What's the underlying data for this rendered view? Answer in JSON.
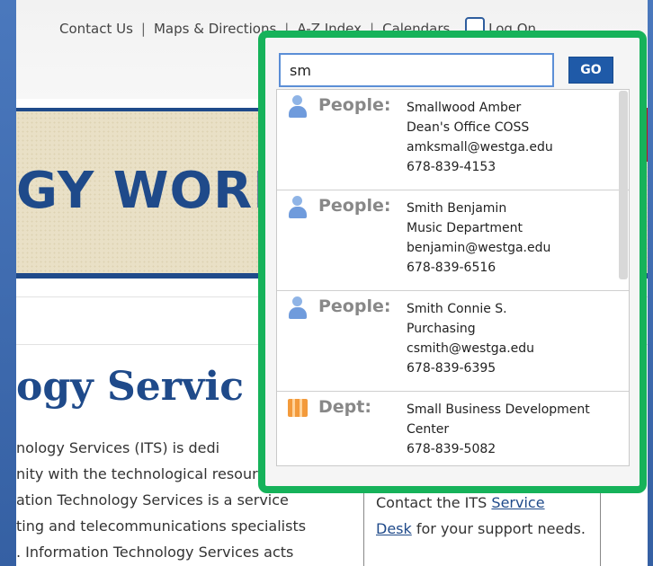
{
  "utility_nav": {
    "links": [
      "Contact Us",
      "Maps & Directions",
      "A-Z Index",
      "Calendars"
    ],
    "logon_label": "Log On"
  },
  "banner": {
    "text": "GY WORK F"
  },
  "page": {
    "heading": "ogy Servic",
    "body_lines": [
      "nology Services (ITS) is dedi",
      "nity with the technological resources",
      "ation Technology Services is a service",
      "ting and telecommunications specialists",
      ". Information Technology Services acts"
    ],
    "sidebar_pre": "Contact the ITS ",
    "sidebar_link1": "Service",
    "sidebar_link2": "Desk",
    "sidebar_post": " for your support needs."
  },
  "search": {
    "query": "sm",
    "go_label": "GO",
    "results": [
      {
        "type": "People:",
        "icon": "person-icon",
        "lines": [
          "Smallwood Amber",
          "Dean's Office COSS",
          "amksmall@westga.edu",
          "678-839-4153"
        ]
      },
      {
        "type": "People:",
        "icon": "person-icon",
        "lines": [
          "Smith Benjamin",
          "Music Department",
          "benjamin@westga.edu",
          "678-839-6516"
        ]
      },
      {
        "type": "People:",
        "icon": "person-icon",
        "lines": [
          "Smith Connie S.",
          "Purchasing",
          "csmith@westga.edu",
          "678-839-6395"
        ]
      },
      {
        "type": "Dept:",
        "icon": "building-icon",
        "lines": [
          "Small Business Development",
          "Center",
          "678-839-5082"
        ]
      }
    ]
  },
  "colors": {
    "highlight": "#16b25a",
    "brand_blue": "#1f4a8a",
    "go_button": "#1f5aa8"
  }
}
